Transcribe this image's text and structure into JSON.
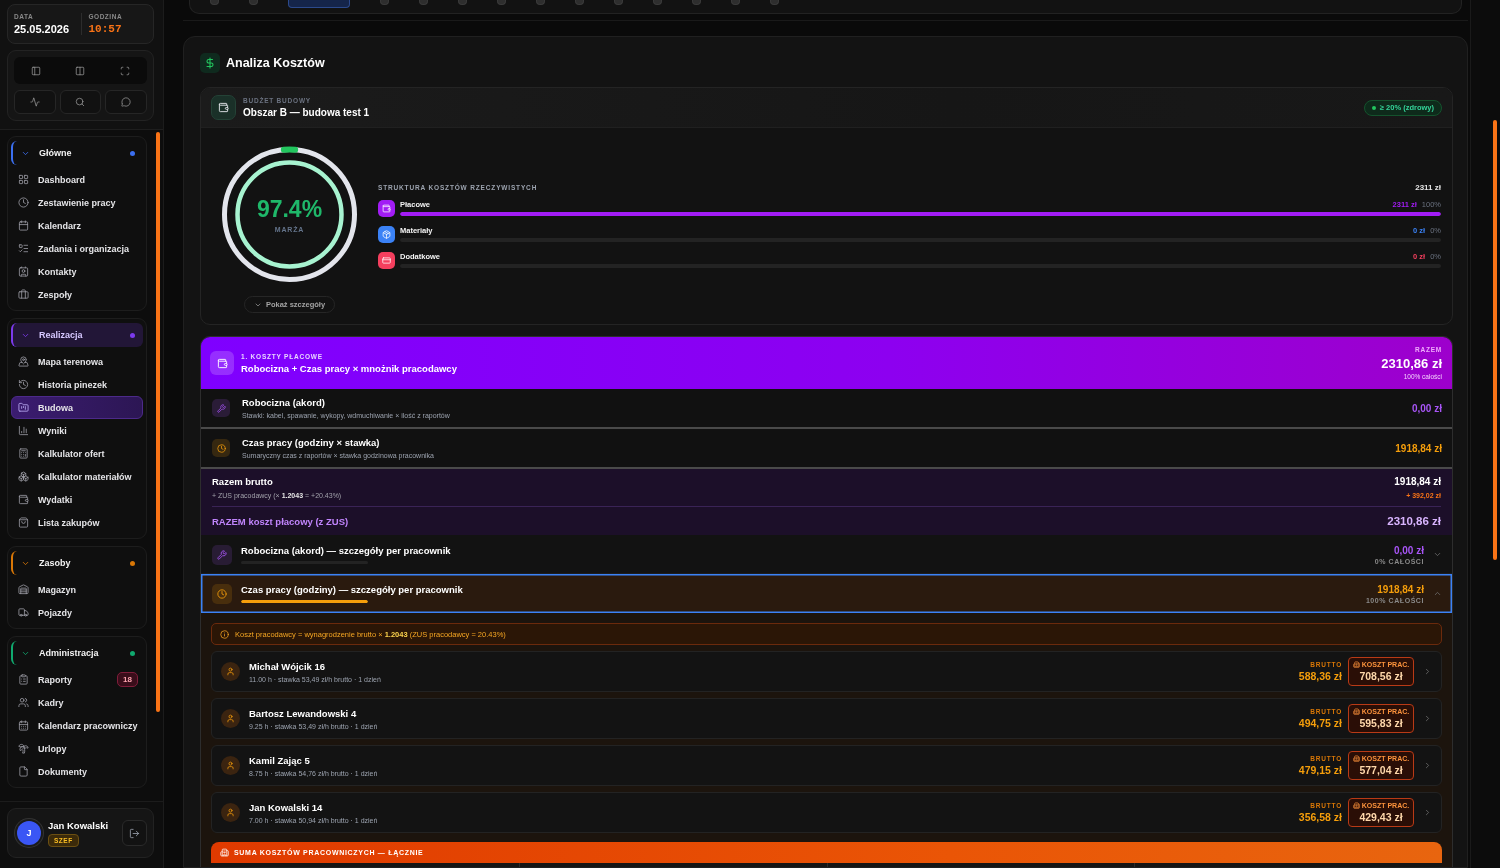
{
  "toolbar": {
    "tabs": [
      {
        "selected": false
      },
      {
        "selected": false
      },
      {
        "selected": true
      },
      {
        "selected": false
      },
      {
        "selected": false
      },
      {
        "selected": false
      },
      {
        "selected": false
      },
      {
        "selected": false
      },
      {
        "selected": false
      },
      {
        "selected": false
      },
      {
        "selected": false
      },
      {
        "selected": false
      },
      {
        "selected": false
      },
      {
        "selected": false
      }
    ]
  },
  "sidebar": {
    "date": {
      "label": "DATA",
      "value": "25.05.2026"
    },
    "time": {
      "label": "GODZINA",
      "value": "10:57"
    },
    "groups": [
      {
        "title": "Główne",
        "color": "#3b6ff0",
        "expanded": true,
        "items": [
          {
            "label": "Dashboard",
            "selected": false
          },
          {
            "label": "Zestawienie pracy",
            "selected": false
          },
          {
            "label": "Kalendarz",
            "selected": false
          },
          {
            "label": "Zadania i organizacja",
            "selected": false
          },
          {
            "label": "Kontakty",
            "selected": false
          },
          {
            "label": "Zespoły",
            "selected": false
          }
        ]
      },
      {
        "title": "Realizacja",
        "color": "#7c3aed",
        "expanded": true,
        "items": [
          {
            "label": "Mapa terenowa",
            "selected": false
          },
          {
            "label": "Historia pinezek",
            "selected": false
          },
          {
            "label": "Budowa",
            "selected": true
          },
          {
            "label": "Wyniki",
            "selected": false
          },
          {
            "label": "Kalkulator ofert",
            "selected": false
          },
          {
            "label": "Kalkulator materiałów",
            "selected": false
          },
          {
            "label": "Wydatki",
            "selected": false
          },
          {
            "label": "Lista zakupów",
            "selected": false
          }
        ]
      },
      {
        "title": "Zasoby",
        "color": "#d97706",
        "expanded": true,
        "items": [
          {
            "label": "Magazyn",
            "selected": false
          },
          {
            "label": "Pojazdy",
            "selected": false
          }
        ]
      },
      {
        "title": "Administracja",
        "color": "#10a96f",
        "expanded": true,
        "items": [
          {
            "label": "Raporty",
            "selected": false,
            "badge": "18"
          },
          {
            "label": "Kadry",
            "selected": false
          },
          {
            "label": "Kalendarz pracowniczy",
            "selected": false
          },
          {
            "label": "Urlopy",
            "selected": false
          },
          {
            "label": "Dokumenty",
            "selected": false
          }
        ]
      }
    ],
    "user": {
      "initial": "J",
      "name": "Jan Kowalski",
      "role": "SZEF"
    }
  },
  "cost_analysis": {
    "title": "Analiza Kosztów",
    "budget": {
      "label": "BUDŻET BUDOWY",
      "name": "Obszar B — budowa test 1",
      "status": "≥ 20% (zdrowy)",
      "margin": {
        "value": "97.4%",
        "label": "MARŻA"
      },
      "details_button": "Pokaż szczegóły",
      "structure": {
        "title": "STRUKTURA KOSZTÓW RZECZYWISTYCH",
        "total": "2311 zł",
        "items": [
          {
            "label": "Płacowe",
            "amount": "2311 zł",
            "share": "100%",
            "level": 1,
            "color": "#a21cf5"
          },
          {
            "label": "Materiały",
            "amount": "0 zł",
            "share": "0%",
            "level": 0,
            "color": "#3b82f6"
          },
          {
            "label": "Dodatkowe",
            "amount": "0 zł",
            "share": "0%",
            "level": 0,
            "color": "#f43f5e"
          }
        ]
      }
    },
    "labor": {
      "number_label": "1. KOSZTY PŁACOWE",
      "title": "Robocizna + Czas pracy × mnożnik pracodawcy",
      "total_label": "RAZEM",
      "total": "2310,86 zł",
      "total_share": "100% całości",
      "components": [
        {
          "title": "Robocizna (akord)",
          "subtitle": "Stawki: kabel, spawanie, wykopy, wdmuchiwanie × ilość z raportów",
          "amount": "0,00 zł",
          "color": "#a855f7"
        },
        {
          "title": "Czas pracy (godziny × stawka)",
          "subtitle": "Sumaryczny czas z raportów × stawka godzinowa pracownika",
          "amount": "1918,84 zł",
          "color": "#f59e0b"
        }
      ],
      "summary": {
        "gross_label": "Razem brutto",
        "gross": "1918,84 zł",
        "zus_note": "+ ZUS pracodawcy (× **1.2043** = +20.43%)",
        "zus_amount": "+ 392,02 zł",
        "total_label": "RAZEM koszt płacowy (z ZUS)",
        "total": "2310,86 zł"
      },
      "breakdowns": [
        {
          "title": "Robocizna (akord) — szczegóły per pracownik",
          "amount": "0,00 zł",
          "share": "0% CAŁOŚCI",
          "level": 0,
          "expanded": false,
          "color": "#a855f7"
        },
        {
          "title": "Czas pracy (godziny) — szczegóły per pracownik",
          "amount": "1918,84 zł",
          "share": "100% CAŁOŚCI",
          "level": 1,
          "expanded": true,
          "color": "#f59e0b",
          "notice": "Koszt pracodawcy = wynagrodzenie brutto × **1.2043** (ZUS pracodawcy = 20.43%)",
          "workers": [
            {
              "name": "Michał Wójcik 16",
              "details": "11.00 h · stawka 53,49 zł/h brutto · 1 dzień",
              "gross_label": "BRUTTO",
              "gross": "588,36 zł",
              "cost_label": "KOSZT PRAC.",
              "cost": "708,56 zł"
            },
            {
              "name": "Bartosz Lewandowski 4",
              "details": "9.25 h · stawka 53,49 zł/h brutto · 1 dzień",
              "gross_label": "BRUTTO",
              "gross": "494,75 zł",
              "cost_label": "KOSZT PRAC.",
              "cost": "595,83 zł"
            },
            {
              "name": "Kamil Zając 5",
              "details": "8.75 h · stawka 54,76 zł/h brutto · 1 dzień",
              "gross_label": "BRUTTO",
              "gross": "479,15 zł",
              "cost_label": "KOSZT PRAC.",
              "cost": "577,04 zł"
            },
            {
              "name": "Jan Kowalski 14",
              "details": "7.00 h · stawka 50,94 zł/h brutto · 1 dzień",
              "gross_label": "BRUTTO",
              "gross": "356,58 zł",
              "cost_label": "KOSZT PRAC.",
              "cost": "429,43 zł"
            }
          ],
          "summary_title": "SUMA KOSZTÓW PRACOWNICZYCH — ŁĄCZNIE"
        }
      ]
    }
  }
}
